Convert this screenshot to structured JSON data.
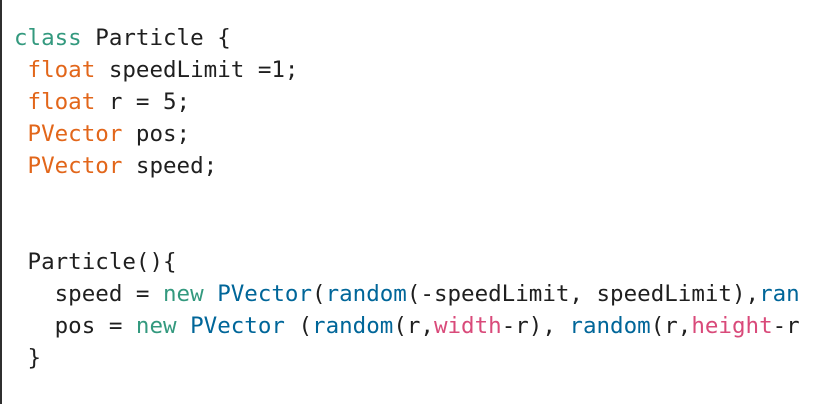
{
  "editor": {
    "lines": [
      [
        {
          "text": "class",
          "kind": "keyword"
        },
        {
          "text": " Particle {",
          "kind": "plain"
        }
      ],
      [
        {
          "text": " ",
          "kind": "plain"
        },
        {
          "text": "float",
          "kind": "type"
        },
        {
          "text": " speedLimit =1;",
          "kind": "plain"
        }
      ],
      [
        {
          "text": " ",
          "kind": "plain"
        },
        {
          "text": "float",
          "kind": "type"
        },
        {
          "text": " r = 5;",
          "kind": "plain"
        }
      ],
      [
        {
          "text": " ",
          "kind": "plain"
        },
        {
          "text": "PVector",
          "kind": "type"
        },
        {
          "text": " pos;",
          "kind": "plain"
        }
      ],
      [
        {
          "text": " ",
          "kind": "plain"
        },
        {
          "text": "PVector",
          "kind": "type"
        },
        {
          "text": " speed;",
          "kind": "plain"
        }
      ],
      [],
      [],
      [
        {
          "text": " Particle(){",
          "kind": "plain"
        }
      ],
      [
        {
          "text": "   speed = ",
          "kind": "plain"
        },
        {
          "text": "new",
          "kind": "new"
        },
        {
          "text": " ",
          "kind": "plain"
        },
        {
          "text": "PVector",
          "kind": "class"
        },
        {
          "text": "(",
          "kind": "plain"
        },
        {
          "text": "random",
          "kind": "func"
        },
        {
          "text": "(-speedLimit, speedLimit),",
          "kind": "plain"
        },
        {
          "text": "ran",
          "kind": "func"
        }
      ],
      [
        {
          "text": "   pos = ",
          "kind": "plain"
        },
        {
          "text": "new",
          "kind": "new"
        },
        {
          "text": " ",
          "kind": "plain"
        },
        {
          "text": "PVector",
          "kind": "class"
        },
        {
          "text": " (",
          "kind": "plain"
        },
        {
          "text": "random",
          "kind": "func"
        },
        {
          "text": "(r,",
          "kind": "plain"
        },
        {
          "text": "width",
          "kind": "builtin"
        },
        {
          "text": "-r), ",
          "kind": "plain"
        },
        {
          "text": "random",
          "kind": "func"
        },
        {
          "text": "(r,",
          "kind": "plain"
        },
        {
          "text": "height",
          "kind": "builtin"
        },
        {
          "text": "-r",
          "kind": "plain"
        }
      ],
      [
        {
          "text": " }",
          "kind": "plain"
        }
      ]
    ]
  },
  "colors": {
    "background": "#ffffff",
    "text": "#1f1f1f",
    "keyword": "#33997e",
    "type": "#e2661a",
    "class_name": "#006699",
    "function": "#006699",
    "builtin": "#d94a7a",
    "gutter_border": "#2f2f2f"
  }
}
